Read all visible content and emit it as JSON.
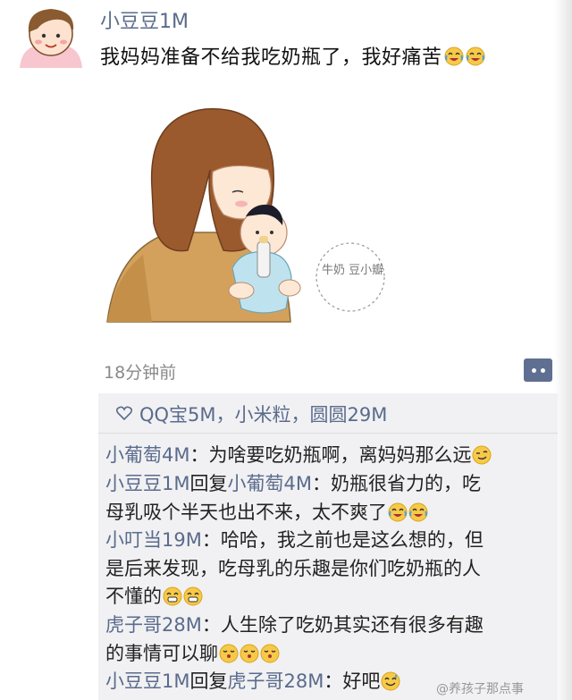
{
  "post": {
    "username": "小豆豆1M",
    "text": "我妈妈准备不给我吃奶瓶了，我好痛苦",
    "text_emojis": [
      "laugh-cry-emoji",
      "laugh-cry-emoji"
    ],
    "timestamp": "18分钟前",
    "image_stamp_text": "牛奶 豆小瓣"
  },
  "likes": {
    "icon": "heart-outline-icon",
    "text": "QQ宝5M，小米粒，圆圆29M"
  },
  "comments": [
    {
      "author": "小豆豆1M",
      "reply_word": "",
      "reply_to": "",
      "sep": "：",
      "lines": [
        "为啥要吃奶瓶啊，离妈妈那么远"
      ],
      "author_alt": "小葡萄4M",
      "emojis": [
        "smirk-emoji"
      ]
    },
    {
      "author": "小豆豆1M",
      "reply_word": "回复",
      "reply_to": "小葡萄4M",
      "sep": "：",
      "lines": [
        "奶瓶很省力的，吃",
        "母乳吸个半天也出不来，太不爽了"
      ],
      "emojis": [
        "laugh-cry-emoji",
        "laugh-cry-emoji"
      ]
    },
    {
      "author": "小叮当19M",
      "reply_word": "",
      "reply_to": "",
      "sep": "：",
      "lines": [
        "哈哈，我之前也是这么想的，但",
        "是后来发现，吃母乳的乐趣是你们吃奶瓶的人",
        "不懂的"
      ],
      "emojis": [
        "grin-emoji",
        "grin-emoji"
      ]
    },
    {
      "author": "虎子哥28M",
      "reply_word": "",
      "reply_to": "",
      "sep": "：",
      "lines": [
        "人生除了吃奶其实还有很多有趣",
        "的事情可以聊"
      ],
      "emojis": [
        "kiss-emoji",
        "kiss-emoji",
        "kiss-emoji"
      ]
    },
    {
      "author": "小豆豆1M",
      "reply_word": "回复",
      "reply_to": "虎子哥28M",
      "sep": "：",
      "lines": [
        "好吧"
      ],
      "emojis": [
        "sweat-smile-emoji"
      ]
    }
  ],
  "comment1_author": "小葡萄4M",
  "watermark": "@养孩子那点事",
  "colors": {
    "nickname": "#5a6b8c",
    "panel_bg": "#f1f1f3",
    "more_button": "#5f6f92"
  }
}
